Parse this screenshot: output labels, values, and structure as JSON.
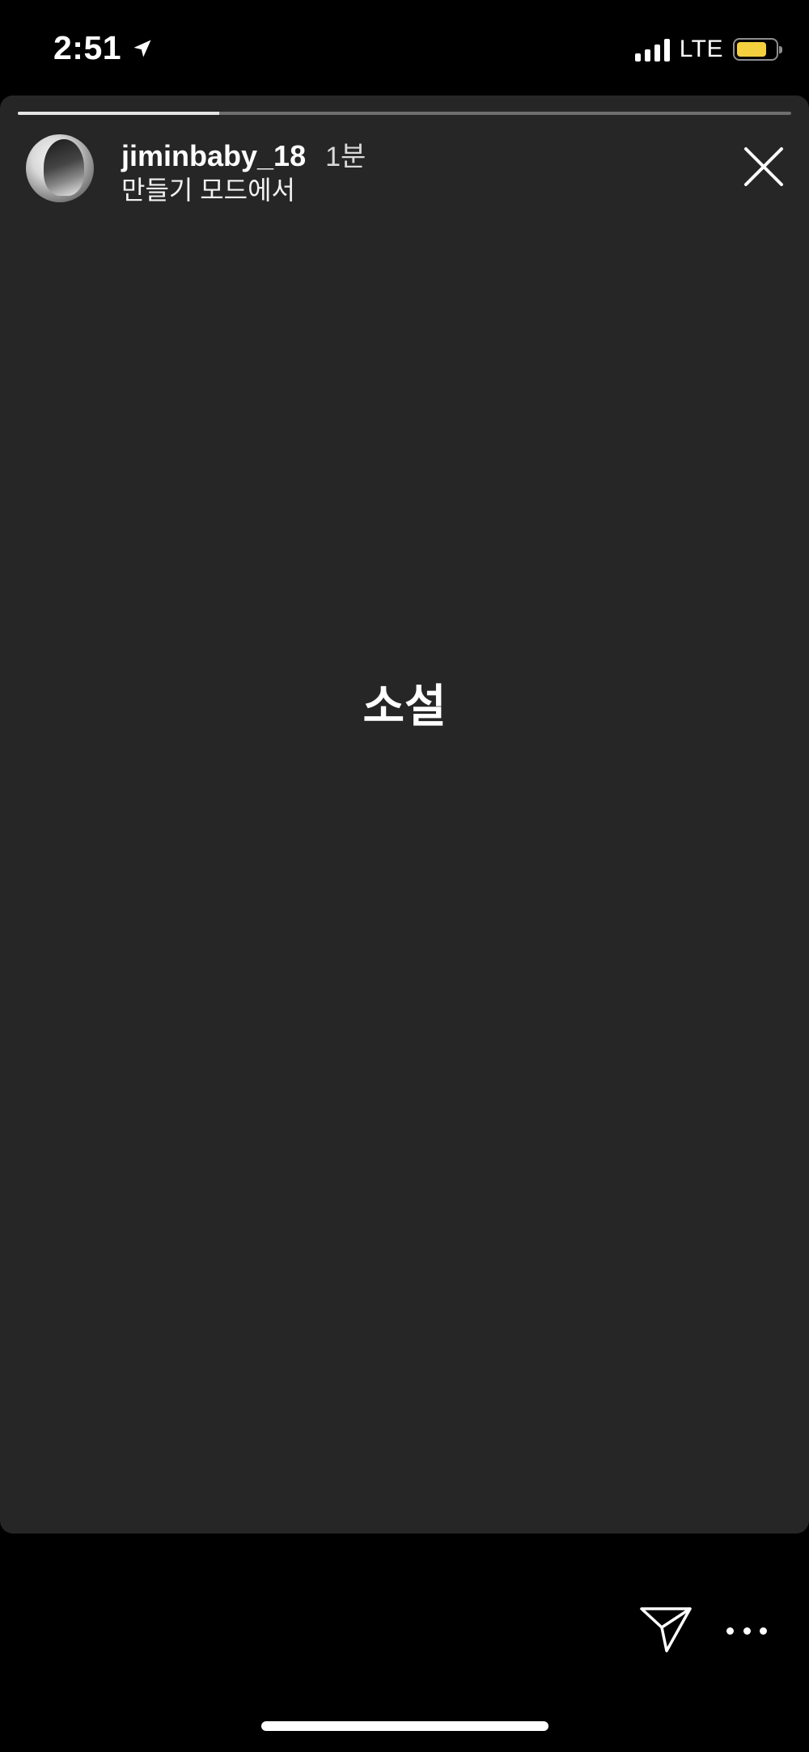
{
  "status_bar": {
    "time": "2:51",
    "network": "LTE",
    "battery_color": "#f4d03f",
    "icons": [
      "location-arrow-icon",
      "signal-bars-icon",
      "battery-icon"
    ]
  },
  "story": {
    "progress": 0.26,
    "username": "jiminbaby_18",
    "time_ago": "1분",
    "subtitle": "만들기 모드에서",
    "text": "소설",
    "background_color": "#262626"
  },
  "actions": {
    "icons": [
      "close-icon",
      "send-icon",
      "more-icon"
    ]
  }
}
